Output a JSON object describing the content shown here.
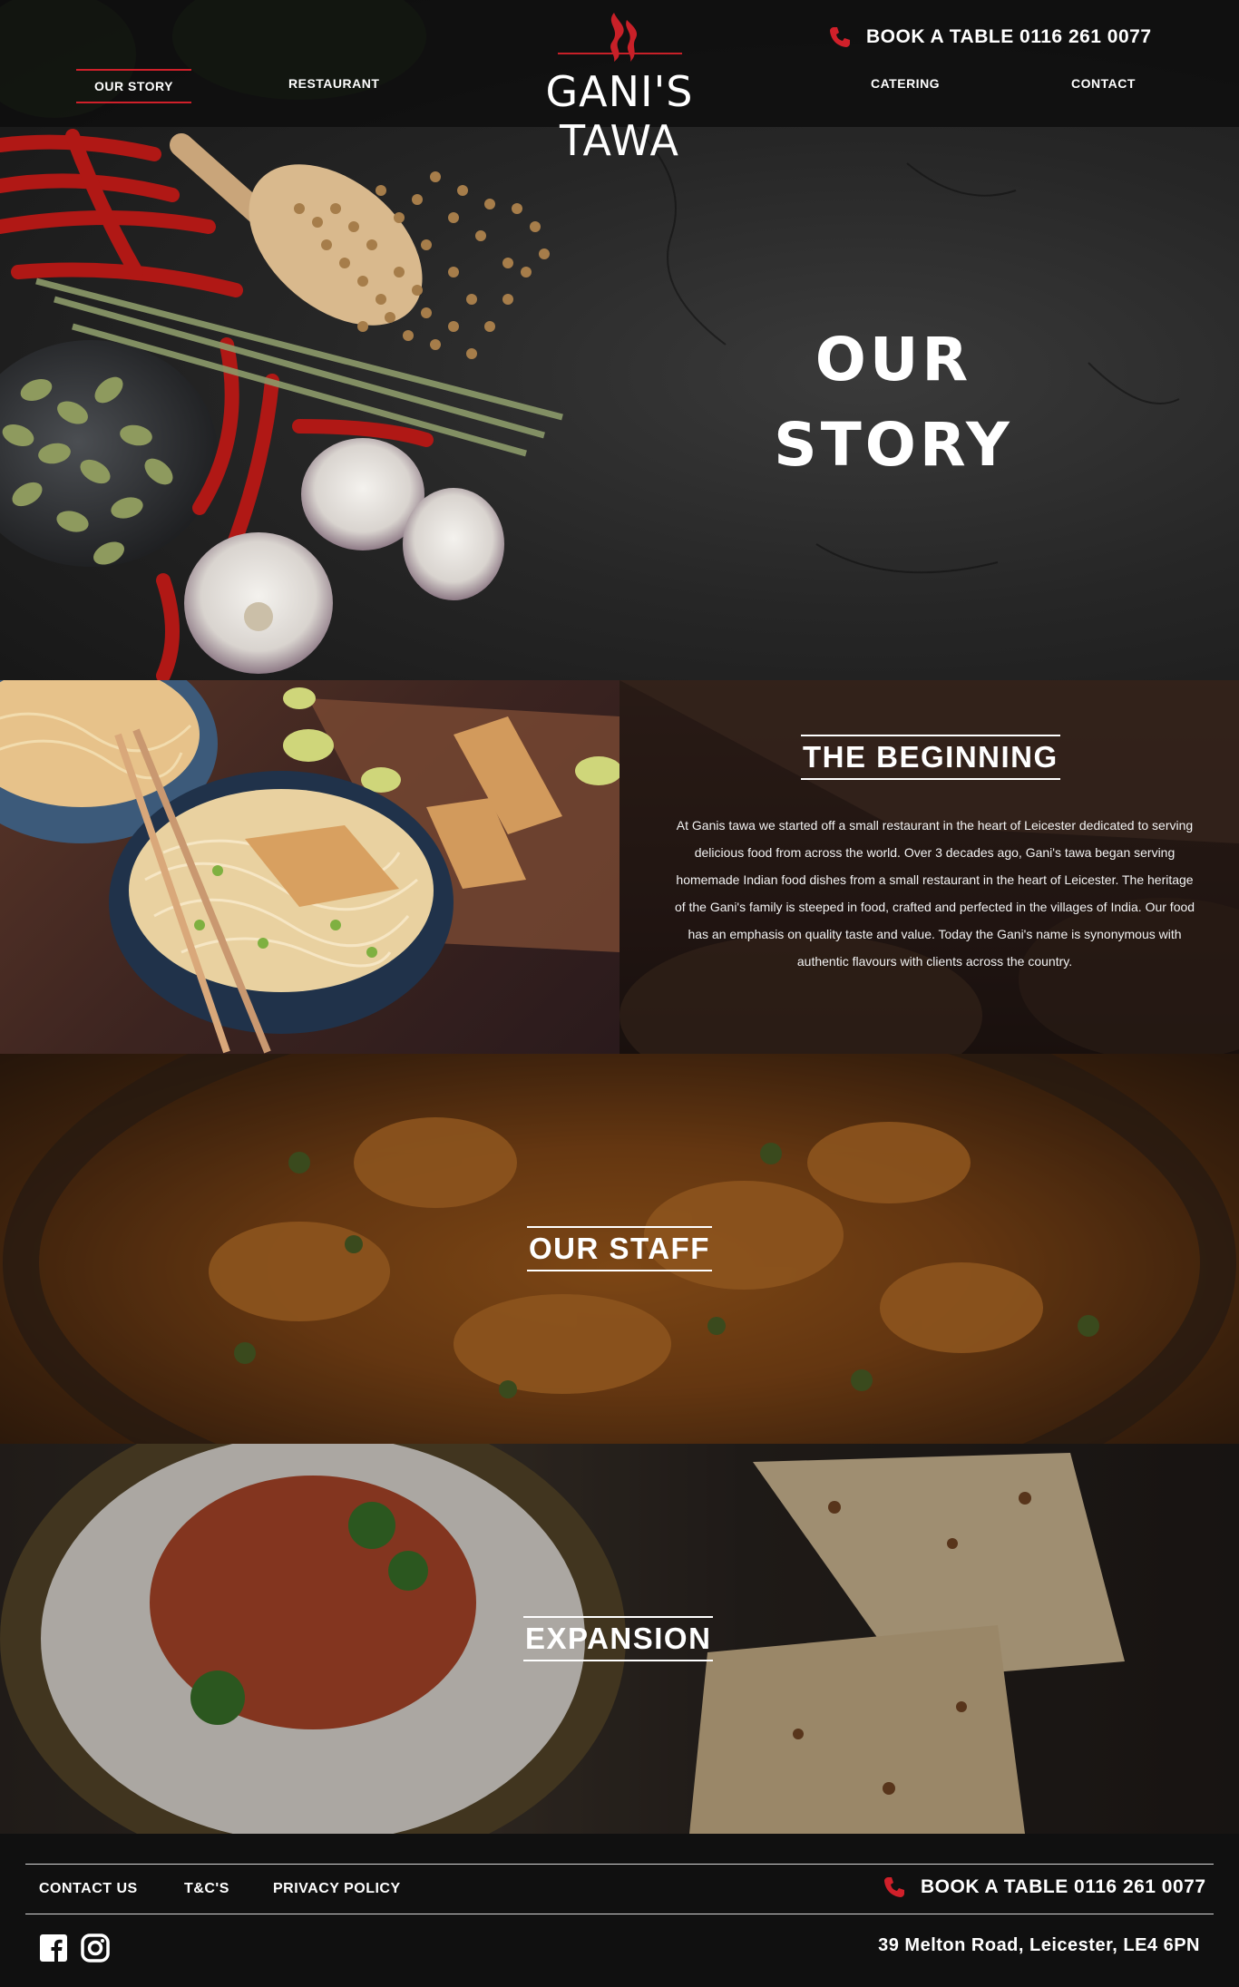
{
  "header": {
    "nav": [
      {
        "label": "OUR STORY",
        "active": true
      },
      {
        "label": "RESTAURANT",
        "active": false
      },
      {
        "label": "CATERING",
        "active": false
      },
      {
        "label": "CONTACT",
        "active": false
      }
    ],
    "logo_text": "GANI'S TAWA",
    "book_label": "BOOK A TABLE 0116 261 0077"
  },
  "hero": {
    "title_line1": "OUR",
    "title_line2": "STORY"
  },
  "beginning": {
    "heading": "THE BEGINNING",
    "body": "At Ganis tawa we started off a small restaurant in the heart of Leicester dedicated to serving delicious food from across the world. Over 3 decades ago, Gani's tawa began serving homemade Indian food dishes from a small restaurant in the heart of Leicester. The heritage of the Gani's family is steeped in food, crafted and perfected in the villages of India. Our food has an emphasis on quality taste and value. Today the Gani's name is synonymous with authentic flavours with clients across the country."
  },
  "staff": {
    "heading": "OUR STAFF"
  },
  "expansion": {
    "heading": "EXPANSION"
  },
  "footer": {
    "links": [
      "CONTACT US",
      "T&C'S",
      "PRIVACY POLICY"
    ],
    "book_label": "BOOK A TABLE 0116 261 0077",
    "address": "39 Melton Road, Leicester, LE4 6PN"
  },
  "icons": {
    "phone": "phone-icon",
    "facebook": "facebook-icon",
    "instagram": "instagram-icon",
    "logo": "flame-icon"
  },
  "colors": {
    "accent": "#d0202a",
    "header_bg": "#0e0e0e",
    "footer_bg": "#101010"
  }
}
